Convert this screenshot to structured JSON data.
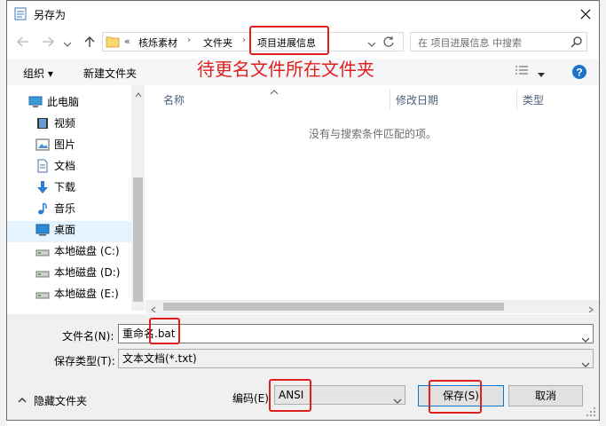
{
  "window": {
    "title": "另存为"
  },
  "address": {
    "crumbs": [
      "«",
      "核烁素材",
      "文件夹",
      "项目进展信息"
    ],
    "placeholder": "在 项目进展信息 中搜索"
  },
  "toolbar": {
    "organize": "组织 ▾",
    "new_folder": "新建文件夹"
  },
  "annotation": "待更名文件所在文件夹",
  "nav": {
    "items": [
      {
        "label": "此电脑",
        "icon": "computer-icon"
      },
      {
        "label": "视频",
        "icon": "video-icon"
      },
      {
        "label": "图片",
        "icon": "pictures-icon"
      },
      {
        "label": "文档",
        "icon": "documents-icon"
      },
      {
        "label": "下载",
        "icon": "download-icon"
      },
      {
        "label": "音乐",
        "icon": "music-icon"
      },
      {
        "label": "桌面",
        "icon": "desktop-icon"
      },
      {
        "label": "本地磁盘 (C:)",
        "icon": "disk-icon"
      },
      {
        "label": "本地磁盘 (D:)",
        "icon": "disk-icon"
      },
      {
        "label": "本地磁盘 (E:)",
        "icon": "disk-icon"
      }
    ]
  },
  "list": {
    "col_name": "名称",
    "col_modified": "修改日期",
    "col_type": "类型",
    "empty": "没有与搜索条件匹配的项。"
  },
  "form": {
    "filename_label": "文件名(N):",
    "filename_value": "重命名.bat",
    "filetype_label": "保存类型(T):",
    "filetype_value": "文本文档(*.txt)",
    "hide_folders": "隐藏文件夹",
    "encoding_label": "编码(E)",
    "encoding_value": "ANSI",
    "save": "保存(S)",
    "cancel": "取消"
  },
  "colors": {
    "accent": "#0078d7",
    "annotation": "#e0201e"
  }
}
